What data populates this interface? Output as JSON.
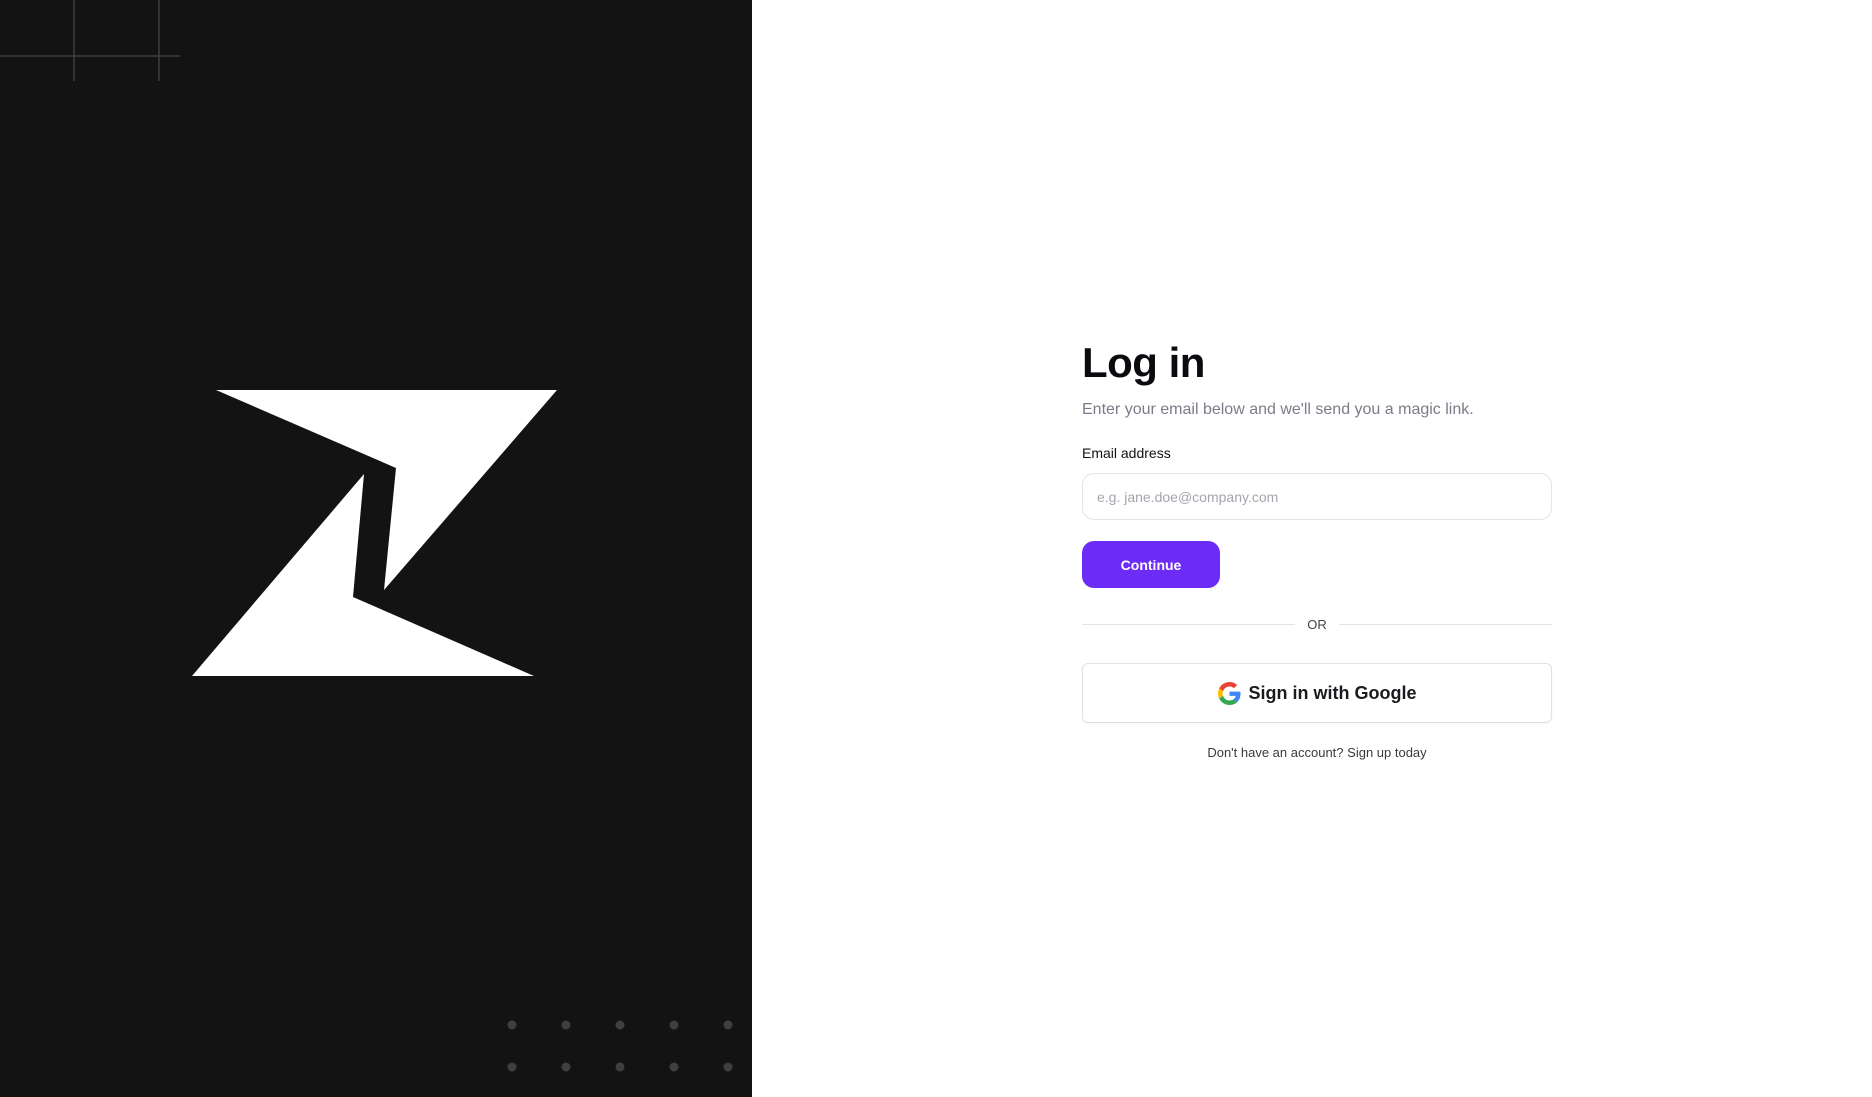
{
  "login": {
    "title": "Log in",
    "subtitle": "Enter your email below and we'll send you a magic link.",
    "email_label": "Email address",
    "email_placeholder": "e.g. jane.doe@company.com",
    "email_value": "",
    "continue_label": "Continue",
    "divider_text": "OR",
    "google_label": "Sign in with Google",
    "signup_prompt": "Don't have an account?",
    "signup_link": "Sign up today"
  },
  "colors": {
    "brand_panel_bg": "#131313",
    "accent": "#6d2cf6",
    "text_primary": "#0b0b0f",
    "text_muted": "#7a7d87"
  },
  "icons": {
    "brand_logo": "z-bolt-logo-icon",
    "google": "google-g-icon"
  }
}
